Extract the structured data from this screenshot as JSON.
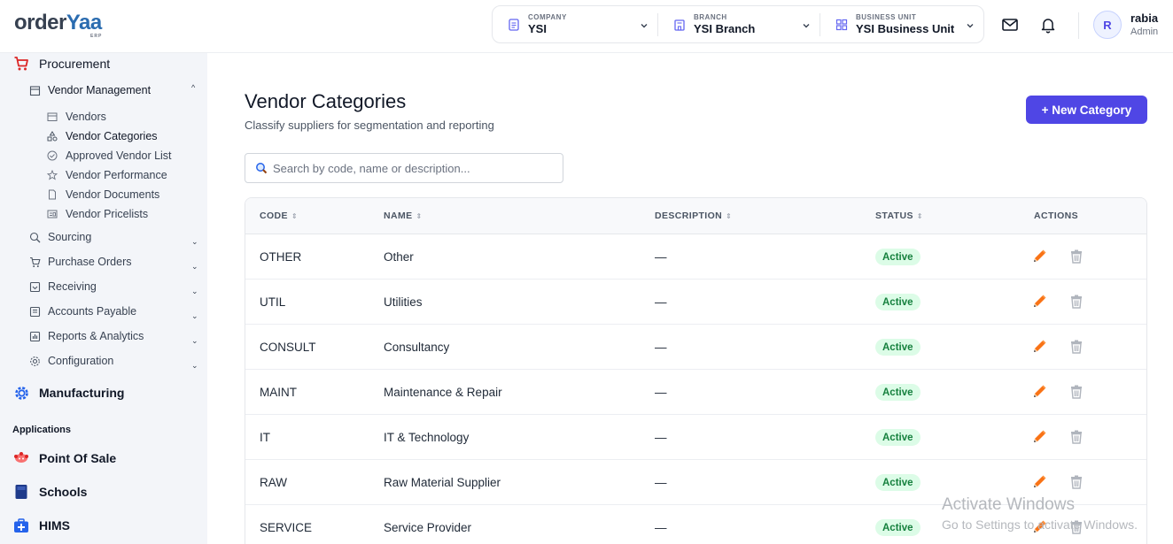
{
  "header": {
    "logo_main_a": "order",
    "logo_main_b": "Yaa",
    "logo_sub": "ERP",
    "company": {
      "label": "COMPANY",
      "value": "YSI"
    },
    "branch": {
      "label": "BRANCH",
      "value": "YSI Branch"
    },
    "business_unit": {
      "label": "BUSINESS UNIT",
      "value": "YSI Business Unit"
    },
    "user": {
      "initial": "R",
      "name": "rabia",
      "role": "Admin"
    }
  },
  "sidebar": {
    "procurement": "Procurement",
    "vendor_management": "Vendor Management",
    "leaves": [
      "Vendors",
      "Vendor Categories",
      "Approved Vendor List",
      "Vendor Performance",
      "Vendor Documents",
      "Vendor Pricelists"
    ],
    "subs": [
      "Sourcing",
      "Purchase Orders",
      "Receiving",
      "Accounts Payable",
      "Reports & Analytics",
      "Configuration"
    ],
    "manufacturing": "Manufacturing",
    "applications_heading": "Applications",
    "apps": [
      "Point Of Sale",
      "Schools",
      "HIMS"
    ]
  },
  "main": {
    "title": "Vendor Categories",
    "subtitle": "Classify suppliers for segmentation and reporting",
    "new_button": "+ New Category",
    "search_placeholder": "Search by code, name or description...",
    "columns": {
      "code": "CODE",
      "name": "NAME",
      "description": "DESCRIPTION",
      "status": "STATUS",
      "actions": "ACTIONS"
    },
    "rows": [
      {
        "code": "OTHER",
        "name": "Other",
        "description": "—",
        "status": "Active"
      },
      {
        "code": "UTIL",
        "name": "Utilities",
        "description": "—",
        "status": "Active"
      },
      {
        "code": "CONSULT",
        "name": "Consultancy",
        "description": "—",
        "status": "Active"
      },
      {
        "code": "MAINT",
        "name": "Maintenance & Repair",
        "description": "—",
        "status": "Active"
      },
      {
        "code": "IT",
        "name": "IT & Technology",
        "description": "—",
        "status": "Active"
      },
      {
        "code": "RAW",
        "name": "Raw Material Supplier",
        "description": "—",
        "status": "Active"
      },
      {
        "code": "SERVICE",
        "name": "Service Provider",
        "description": "—",
        "status": "Active"
      }
    ]
  },
  "watermark": {
    "line1": "Activate Windows",
    "line2": "Go to Settings to activate Windows."
  },
  "colors": {
    "accent": "#4f46e5",
    "active_badge_bg": "#dcfce7",
    "active_badge_text": "#15803d",
    "sidebar_bg": "#f3f5f9"
  },
  "icons": {
    "edit": "pencil-icon",
    "delete": "trash-icon",
    "search": "magnifier-icon"
  }
}
